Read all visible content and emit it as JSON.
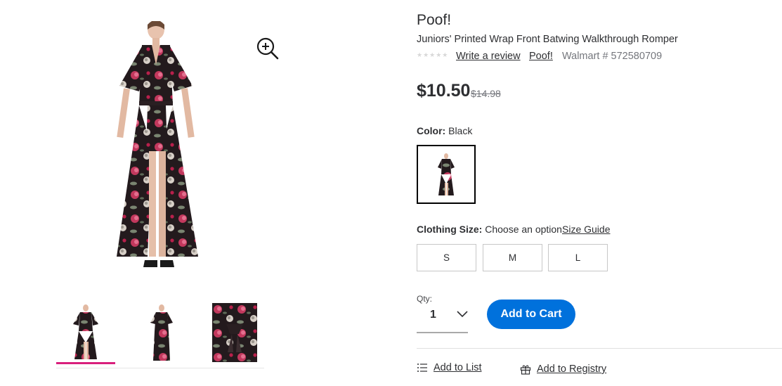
{
  "colors": {
    "accent": "#0071dc",
    "thumb_indicator": "#d91f7c",
    "muted": "#74767c"
  },
  "gallery": {
    "main_image_alt": "product-photo",
    "zoom_icon": "zoom-in-icon",
    "thumbnails": [
      {
        "icon": "thumbnail-full-front",
        "active": true
      },
      {
        "icon": "thumbnail-full-alt",
        "active": false
      },
      {
        "icon": "thumbnail-fabric-closeup",
        "active": false
      }
    ]
  },
  "product": {
    "brand_title": "Poof!",
    "name": "Juniors' Printed Wrap Front Batwing Walkthrough Romper",
    "stars": "★★★★★",
    "rating": 0,
    "write_review": "Write a review",
    "brand_link": "Poof!",
    "item_number": "Walmart # 572580709",
    "price": "$10.50",
    "was_price": "$14.98"
  },
  "color": {
    "label": "Color:",
    "value": "Black"
  },
  "size": {
    "label": "Clothing Size:",
    "value": "Choose an option",
    "guide": "Size Guide",
    "options": [
      "S",
      "M",
      "L"
    ]
  },
  "qty": {
    "label": "Qty:",
    "value": "1"
  },
  "actions": {
    "add_to_cart": "Add to Cart",
    "add_to_list": "Add to List",
    "add_to_registry": "Add to Registry"
  }
}
